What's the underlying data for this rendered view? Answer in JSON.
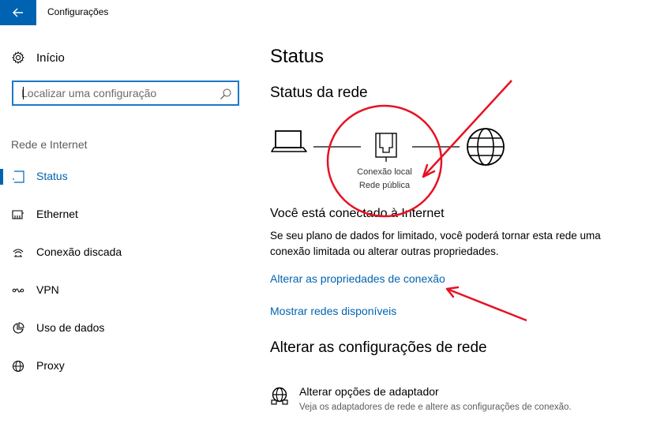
{
  "window": {
    "title": "Configurações"
  },
  "sidebar": {
    "home_label": "Início",
    "search": {
      "placeholder": "Localizar uma configuração",
      "value": ""
    },
    "section_label": "Rede e Internet",
    "items": [
      {
        "label": "Status",
        "icon": "status-icon",
        "selected": true
      },
      {
        "label": "Ethernet",
        "icon": "ethernet-icon",
        "selected": false
      },
      {
        "label": "Conexão discada",
        "icon": "dialup-icon",
        "selected": false
      },
      {
        "label": "VPN",
        "icon": "vpn-icon",
        "selected": false
      },
      {
        "label": "Uso de dados",
        "icon": "data-usage-icon",
        "selected": false
      },
      {
        "label": "Proxy",
        "icon": "globe-icon",
        "selected": false
      }
    ]
  },
  "main": {
    "title": "Status",
    "network_status_title": "Status da rede",
    "diagram": {
      "connection_name": "Conexão local",
      "network_type": "Rede pública"
    },
    "connected_title": "Você está conectado à Internet",
    "connected_desc": "Se seu plano de dados for limitado, você poderá tornar esta rede uma conexão limitada ou alterar outras propriedades.",
    "link_change_properties": "Alterar as propriedades de conexão",
    "link_show_networks": "Mostrar redes disponíveis",
    "change_settings_title": "Alterar as configurações de rede",
    "adapter_option": {
      "label": "Alterar opções de adaptador",
      "description": "Veja os adaptadores de rede e altere as configurações de conexão."
    }
  },
  "colors": {
    "accent": "#0063b1",
    "annotation": "#e81123"
  }
}
